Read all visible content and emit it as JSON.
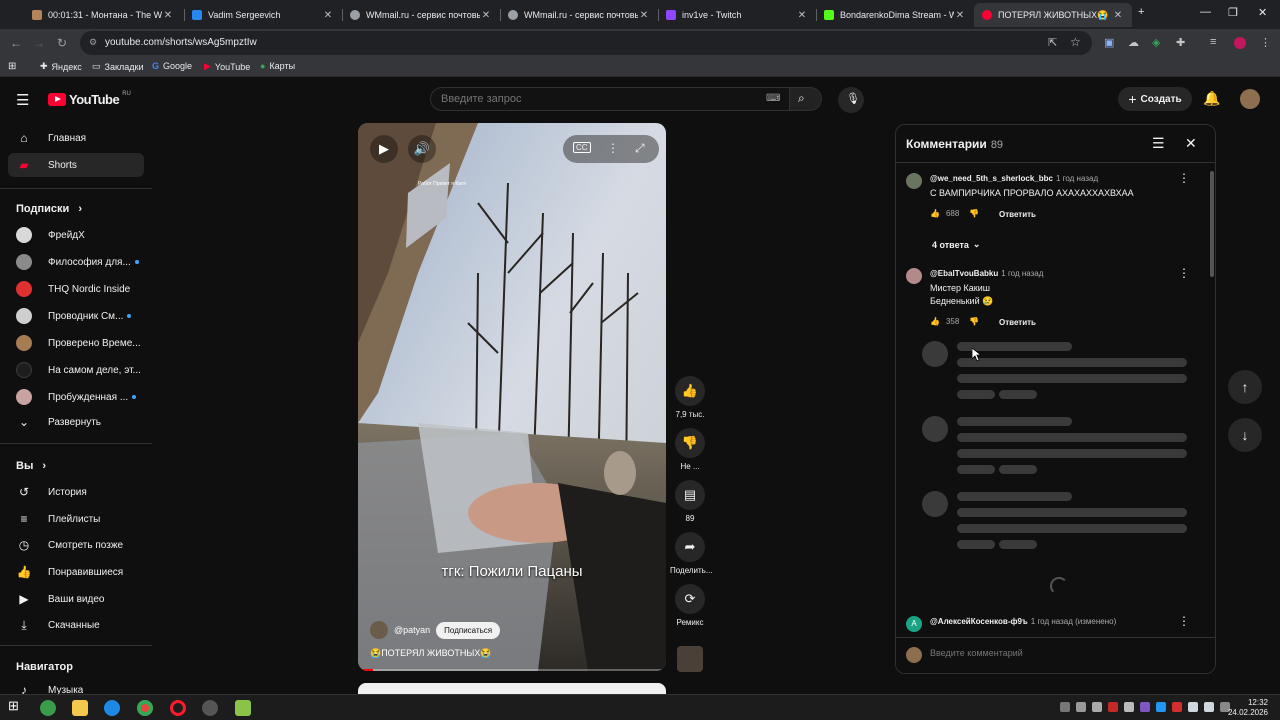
{
  "browser": {
    "tabs": [
      {
        "title": "00:01:31 - Монтана - The West",
        "favicon_color": "#b5835a"
      },
      {
        "title": "Vadim Sergeevich",
        "favicon_color": "#2787f5"
      },
      {
        "title": "WMmail.ru - сервис почтовых",
        "favicon_color": "#9aa0a6"
      },
      {
        "title": "WMmail.ru - сервис почтовых",
        "favicon_color": "#9aa0a6"
      },
      {
        "title": "inv1ve - Twitch",
        "favicon_color": "#9146ff"
      },
      {
        "title": "BondarenkoDima Stream - Wat",
        "favicon_color": "#53fc18"
      },
      {
        "title": "ПОТЕРЯЛ ЖИВОТНЫХ😭",
        "favicon_color": "#ff0033"
      }
    ],
    "new_tab": "+",
    "url": "youtube.com/shorts/wsAg5mpztIw",
    "bookmarks": [
      {
        "label": "Яндекс",
        "icon": "plus-icon"
      },
      {
        "label": "Закладки",
        "icon": "folder-icon"
      },
      {
        "label": "Google",
        "icon": "google-icon"
      },
      {
        "label": "YouTube",
        "icon": "youtube-icon"
      },
      {
        "label": "Карты",
        "icon": "map-pin-icon"
      }
    ]
  },
  "youtube": {
    "logo": "YouTube",
    "region": "RU",
    "search_placeholder": "Введите запрос",
    "create_label": "Создать"
  },
  "sidebar": {
    "main": [
      {
        "label": "Главная",
        "icon": "home-icon"
      },
      {
        "label": "Shorts",
        "icon": "shorts-icon"
      }
    ],
    "subs_header": "Подписки",
    "subs": [
      {
        "label": "ФрейдХ",
        "color": "#d9d9d9",
        "dot": false
      },
      {
        "label": "Философия для...",
        "color": "#8a8a8a",
        "dot": true
      },
      {
        "label": "THQ Nordic Inside",
        "color": "#e03131",
        "dot": false
      },
      {
        "label": "Проводник См...",
        "color": "#cfcfcf",
        "dot": true
      },
      {
        "label": "Проверено Време...",
        "color": "#a67c52",
        "dot": false
      },
      {
        "label": "На самом деле, эт...",
        "color": "#1e1e1e",
        "dot": false
      },
      {
        "label": "Пробужденная ...",
        "color": "#c9a2a2",
        "dot": true
      }
    ],
    "expand": "Развернуть",
    "you_header": "Вы",
    "you": [
      {
        "label": "История",
        "icon": "history-icon"
      },
      {
        "label": "Плейлисты",
        "icon": "playlist-icon"
      },
      {
        "label": "Смотреть позже",
        "icon": "clock-icon"
      },
      {
        "label": "Понравившиеся",
        "icon": "thumb-up-icon"
      },
      {
        "label": "Ваши видео",
        "icon": "video-icon"
      },
      {
        "label": "Скачанные",
        "icon": "download-icon"
      }
    ],
    "nav_header": "Навигатор",
    "nav": [
      {
        "label": "Музыка",
        "icon": "music-icon"
      }
    ]
  },
  "video": {
    "overlay_sign": "Работ Привет я Катя",
    "caption": "тгк: Пожили Пацаны",
    "channel": "@patyan",
    "subscribe": "Подписаться",
    "title": "😭ПОТЕРЯЛ ЖИВОТНЫХ😭",
    "progress": 0.05
  },
  "actions": [
    {
      "label": "7,9 тыс.",
      "icon": "thumb-up-icon"
    },
    {
      "label": "Не ...",
      "icon": "thumb-down-icon"
    },
    {
      "label": "89",
      "icon": "comment-icon"
    },
    {
      "label": "Поделить...",
      "icon": "share-icon"
    },
    {
      "label": "Ремикс",
      "icon": "remix-icon"
    }
  ],
  "comments": {
    "title": "Комментарии",
    "count": "89",
    "items": [
      {
        "author": "@we_need_5th_s_sherlock_bbc",
        "time": "1 год назад",
        "text": "С ВАМПИРЧИКА ПРОРВАЛО АХАХАХХАХВХАА",
        "likes": "688",
        "reply": "Ответить",
        "replies": "4 ответа"
      },
      {
        "author": "@EbalTvouBabku",
        "time": "1 год назад",
        "text": "Мистер Какиш",
        "text2": "Бедненький 😢",
        "likes": "358",
        "reply": "Ответить"
      },
      {
        "author": "@АлексейКосенков-ф9ъ",
        "time": "1 год назад (изменено)"
      }
    ],
    "input_placeholder": "Введите комментарий"
  },
  "taskbar": {
    "time": "12:32",
    "date": "24.02.2026"
  }
}
